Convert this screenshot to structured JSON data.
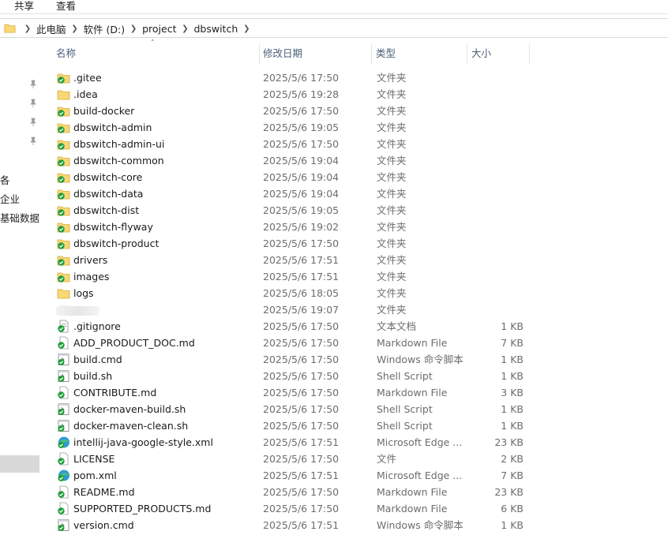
{
  "ribbon": {
    "tabs": [
      "共享",
      "查看"
    ]
  },
  "address": {
    "crumbs": [
      "此电脑",
      "软件 (D:)",
      "project",
      "dbswitch"
    ]
  },
  "nav": {
    "labels": [
      "各",
      "企业",
      "基础数据"
    ]
  },
  "columns": {
    "name": "名称",
    "date": "修改日期",
    "type": "类型",
    "size": "大小"
  },
  "files": [
    {
      "name": ".gitee",
      "date": "2025/5/6 17:50",
      "type": "文件夹",
      "size": "",
      "icon": "folder-synced-icon"
    },
    {
      "name": ".idea",
      "date": "2025/5/6 19:28",
      "type": "文件夹",
      "size": "",
      "icon": "folder-icon"
    },
    {
      "name": "build-docker",
      "date": "2025/5/6 17:50",
      "type": "文件夹",
      "size": "",
      "icon": "folder-synced-icon"
    },
    {
      "name": "dbswitch-admin",
      "date": "2025/5/6 19:05",
      "type": "文件夹",
      "size": "",
      "icon": "folder-synced-icon"
    },
    {
      "name": "dbswitch-admin-ui",
      "date": "2025/5/6 17:50",
      "type": "文件夹",
      "size": "",
      "icon": "folder-synced-icon"
    },
    {
      "name": "dbswitch-common",
      "date": "2025/5/6 19:04",
      "type": "文件夹",
      "size": "",
      "icon": "folder-synced-icon"
    },
    {
      "name": "dbswitch-core",
      "date": "2025/5/6 19:04",
      "type": "文件夹",
      "size": "",
      "icon": "folder-synced-icon"
    },
    {
      "name": "dbswitch-data",
      "date": "2025/5/6 19:04",
      "type": "文件夹",
      "size": "",
      "icon": "folder-synced-icon"
    },
    {
      "name": "dbswitch-dist",
      "date": "2025/5/6 19:05",
      "type": "文件夹",
      "size": "",
      "icon": "folder-synced-icon"
    },
    {
      "name": "dbswitch-flyway",
      "date": "2025/5/6 19:02",
      "type": "文件夹",
      "size": "",
      "icon": "folder-synced-icon"
    },
    {
      "name": "dbswitch-product",
      "date": "2025/5/6 17:50",
      "type": "文件夹",
      "size": "",
      "icon": "folder-synced-icon"
    },
    {
      "name": "drivers",
      "date": "2025/5/6 17:51",
      "type": "文件夹",
      "size": "",
      "icon": "folder-synced-icon"
    },
    {
      "name": "images",
      "date": "2025/5/6 17:51",
      "type": "文件夹",
      "size": "",
      "icon": "folder-synced-icon"
    },
    {
      "name": "logs",
      "date": "2025/5/6 18:05",
      "type": "文件夹",
      "size": "",
      "icon": "folder-icon"
    },
    {
      "name": "",
      "date": "2025/5/6 19:07",
      "type": "文件夹",
      "size": "",
      "icon": "blurred-icon"
    },
    {
      "name": ".gitignore",
      "date": "2025/5/6 17:50",
      "type": "文本文档",
      "size": "1 KB",
      "icon": "text-file-icon"
    },
    {
      "name": "ADD_PRODUCT_DOC.md",
      "date": "2025/5/6 17:50",
      "type": "Markdown File",
      "size": "7 KB",
      "icon": "synced-file-icon"
    },
    {
      "name": "build.cmd",
      "date": "2025/5/6 17:50",
      "type": "Windows 命令脚本",
      "size": "1 KB",
      "icon": "script-file-icon"
    },
    {
      "name": "build.sh",
      "date": "2025/5/6 17:50",
      "type": "Shell Script",
      "size": "1 KB",
      "icon": "script-file-icon"
    },
    {
      "name": "CONTRIBUTE.md",
      "date": "2025/5/6 17:50",
      "type": "Markdown File",
      "size": "3 KB",
      "icon": "synced-file-icon"
    },
    {
      "name": "docker-maven-build.sh",
      "date": "2025/5/6 17:50",
      "type": "Shell Script",
      "size": "1 KB",
      "icon": "script-file-icon"
    },
    {
      "name": "docker-maven-clean.sh",
      "date": "2025/5/6 17:50",
      "type": "Shell Script",
      "size": "1 KB",
      "icon": "script-file-icon"
    },
    {
      "name": "intellij-java-google-style.xml",
      "date": "2025/5/6 17:51",
      "type": "Microsoft Edge ...",
      "size": "23 KB",
      "icon": "edge-file-icon"
    },
    {
      "name": "LICENSE",
      "date": "2025/5/6 17:50",
      "type": "文件",
      "size": "2 KB",
      "icon": "synced-file-icon"
    },
    {
      "name": "pom.xml",
      "date": "2025/5/6 17:51",
      "type": "Microsoft Edge ...",
      "size": "7 KB",
      "icon": "edge-file-icon"
    },
    {
      "name": "README.md",
      "date": "2025/5/6 17:50",
      "type": "Markdown File",
      "size": "23 KB",
      "icon": "synced-file-icon"
    },
    {
      "name": "SUPPORTED_PRODUCTS.md",
      "date": "2025/5/6 17:50",
      "type": "Markdown File",
      "size": "6 KB",
      "icon": "synced-file-icon"
    },
    {
      "name": "version.cmd",
      "date": "2025/5/6 17:51",
      "type": "Windows 命令脚本",
      "size": "1 KB",
      "icon": "script-file-icon"
    }
  ],
  "colors": {
    "folder": "#f8d775",
    "sync_green": "#1f9e3a",
    "header_text": "#4c607a",
    "nav_selected": "#d9d9d9"
  }
}
